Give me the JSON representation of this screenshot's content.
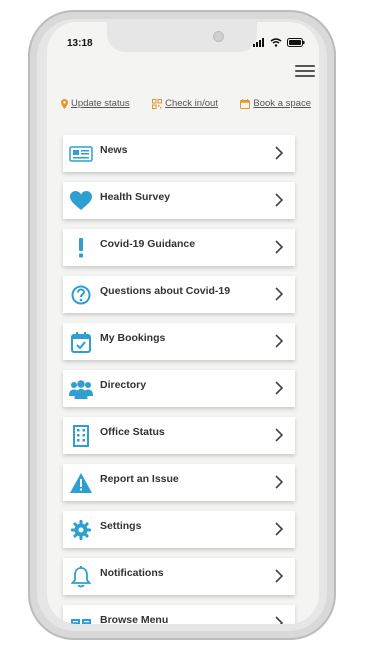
{
  "status_bar": {
    "time": "13:18"
  },
  "quick_links": [
    {
      "label": "Update status",
      "icon": "location-pin-icon"
    },
    {
      "label": "Check in/out",
      "icon": "qr-code-icon"
    },
    {
      "label": "Book a space",
      "icon": "calendar-icon"
    }
  ],
  "menu_items": [
    {
      "label": "News",
      "icon": "newspaper-icon"
    },
    {
      "label": "Health Survey",
      "icon": "heart-icon"
    },
    {
      "label": "Covid-19 Guidance",
      "icon": "exclamation-icon"
    },
    {
      "label": "Questions about Covid-19",
      "icon": "question-circle-icon"
    },
    {
      "label": "My Bookings",
      "icon": "calendar-check-icon"
    },
    {
      "label": "Directory",
      "icon": "people-icon"
    },
    {
      "label": "Office Status",
      "icon": "building-icon"
    },
    {
      "label": "Report an Issue",
      "icon": "warning-icon"
    },
    {
      "label": "Settings",
      "icon": "gear-icon"
    },
    {
      "label": "Notifications",
      "icon": "bell-icon"
    },
    {
      "label": "Browse Menu",
      "icon": "book-icon"
    }
  ],
  "colors": {
    "accent_blue": "#2e9fd0",
    "quick_link_orange": "#e8962c"
  }
}
